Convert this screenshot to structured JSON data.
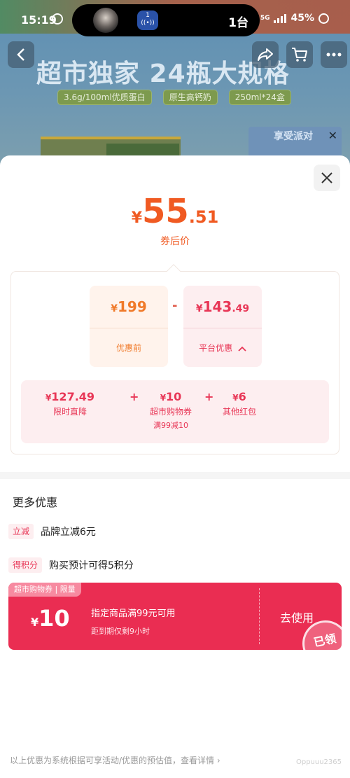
{
  "status_bar": {
    "time": "15:19",
    "network": "5G",
    "battery": "45%"
  },
  "island": {
    "live_badge": "1",
    "count": "1台"
  },
  "background_page": {
    "headline": "超市独家 24瓶大规格",
    "tags": [
      "3.6g/100ml优质蛋白",
      "原生高钙奶",
      "250ml*24盒"
    ],
    "ad_text": "享受派对"
  },
  "price": {
    "currency": "¥",
    "integer": "55",
    "decimal": ".51",
    "label": "券后价"
  },
  "calculation": {
    "before": {
      "integer": "199",
      "decimal": "",
      "label": "优惠前"
    },
    "operator": "-",
    "platform": {
      "integer": "143",
      "decimal": ".49",
      "label": "平台优惠",
      "expand_icon": "chevron-up-icon"
    },
    "breakdown": [
      {
        "value": "127.49",
        "label": "限时直降",
        "sub": ""
      },
      {
        "value": "10",
        "label": "超市购物券",
        "sub": "满99减10"
      },
      {
        "value": "6",
        "label": "其他红包",
        "sub": ""
      }
    ],
    "plus": "+"
  },
  "more": {
    "title": "更多优惠",
    "promos": [
      {
        "tag": "立减",
        "text": "品牌立减6元"
      },
      {
        "tag": "得积分",
        "text": "购买预计可得5积分"
      }
    ]
  },
  "coupon": {
    "tag": "超市购物券 | 限量",
    "currency": "¥",
    "amount": "10",
    "description": "指定商品满99元可用",
    "expiry": "距到期仅剩9小时",
    "button": "去使用",
    "stamp": "已领"
  },
  "footer": {
    "note": "以上优惠为系统根据可享活动/优惠的预估值，查看详情 ›",
    "watermark": "Oppuuu2365"
  },
  "colors": {
    "accent_orange": "#f05a22",
    "accent_red": "#e83656",
    "coupon_red": "#ea2d52"
  }
}
